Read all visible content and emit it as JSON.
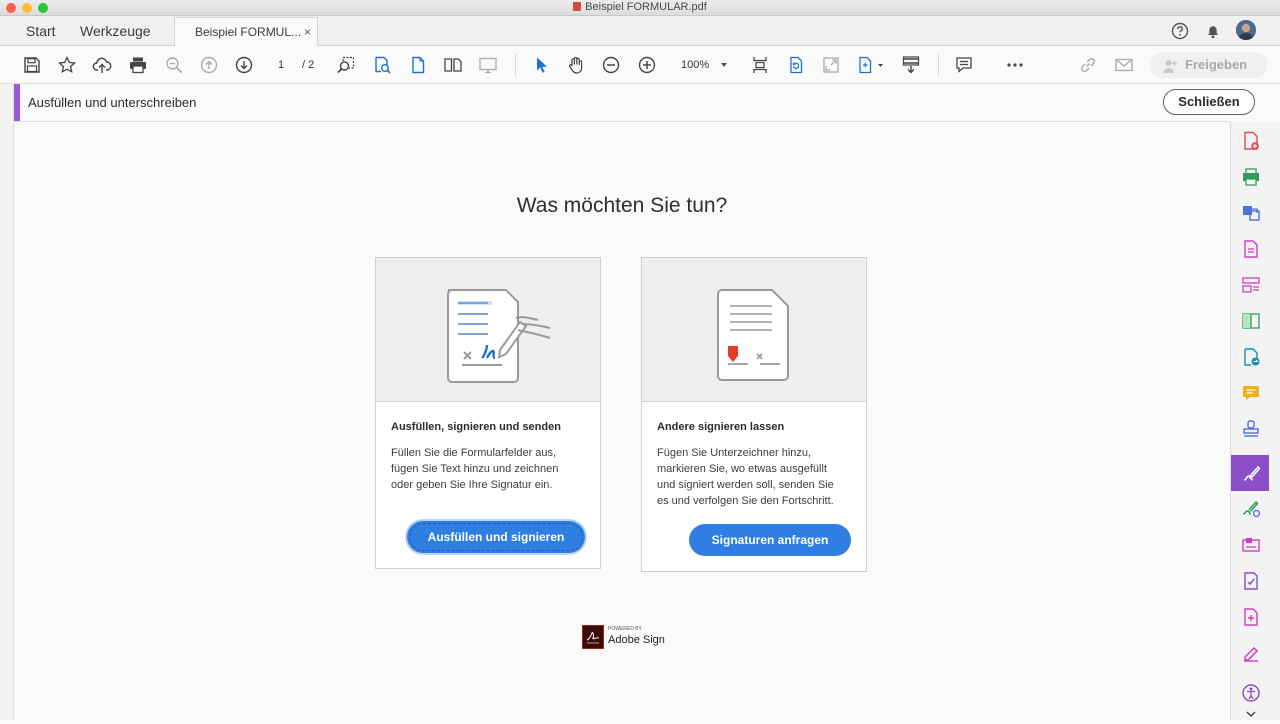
{
  "window": {
    "title": "Beispiel FORMULAR.pdf",
    "colors": {
      "close": "#fd5f57",
      "minimize": "#febc2e",
      "zoom": "#28c840"
    }
  },
  "tabs": {
    "start": "Start",
    "tools": "Werkzeuge",
    "document": "Beispiel FORMUL...",
    "close_glyph": "×"
  },
  "toolbar": {
    "page_current": "1",
    "page_total": "/ 2",
    "zoom": "100%",
    "share_label": "Freigeben",
    "icons": [
      "save-icon",
      "bookmark-star-icon",
      "cloud-upload-icon",
      "print-icon",
      "zoom-search-icon",
      "page-up-icon",
      "page-down-icon",
      "marquee-zoom-icon",
      "find-text-icon",
      "single-page-icon",
      "two-page-icon",
      "presentation-icon",
      "select-cursor-icon",
      "hand-tool-icon",
      "zoom-out-icon",
      "zoom-in-icon",
      "fit-page-icon",
      "rotate-icon",
      "fullscreen-icon",
      "scrolling-mode-icon",
      "read-aloud-icon",
      "comment-icon",
      "more-icon",
      "link-icon",
      "email-icon"
    ]
  },
  "task": {
    "title": "Ausfüllen und unterschreiben",
    "close_label": "Schließen",
    "accent_color": "#9b59d6"
  },
  "main": {
    "heading": "Was möchten Sie tun?",
    "cards": [
      {
        "title": "Ausfüllen, signieren und senden",
        "description_lines": [
          "Füllen Sie die Formularfelder aus,",
          "fügen Sie Text hinzu und zeichnen",
          "oder geben Sie Ihre Signatur ein."
        ],
        "button": "Ausfüllen und signieren"
      },
      {
        "title": "Andere signieren lassen",
        "description_lines": [
          "Fügen Sie Unterzeichner hinzu,",
          "markieren Sie, wo etwas ausgefüllt",
          "und signiert werden soll, senden Sie",
          "es und verfolgen Sie den Fortschritt."
        ],
        "button": "Signaturen anfragen"
      }
    ],
    "footer": {
      "powered_by": "POWERED BY",
      "brand": "Adobe Sign"
    },
    "button_color": "#2f7fe2"
  },
  "right_panel": {
    "icons": [
      "create-pdf-icon",
      "export-pdf-icon",
      "combine-files-icon",
      "edit-pdf-icon",
      "organize-pages-icon",
      "compare-files-icon",
      "send-for-review-icon",
      "comment-tool-icon",
      "stamp-icon",
      "fill-sign-icon",
      "send-for-signature-icon",
      "prepare-form-icon",
      "certificates-icon",
      "protect-icon",
      "measure-icon",
      "accessibility-icon"
    ],
    "active_color": "#8a4fc7"
  },
  "header_icons": [
    "help-icon",
    "bell-icon",
    "avatar"
  ]
}
